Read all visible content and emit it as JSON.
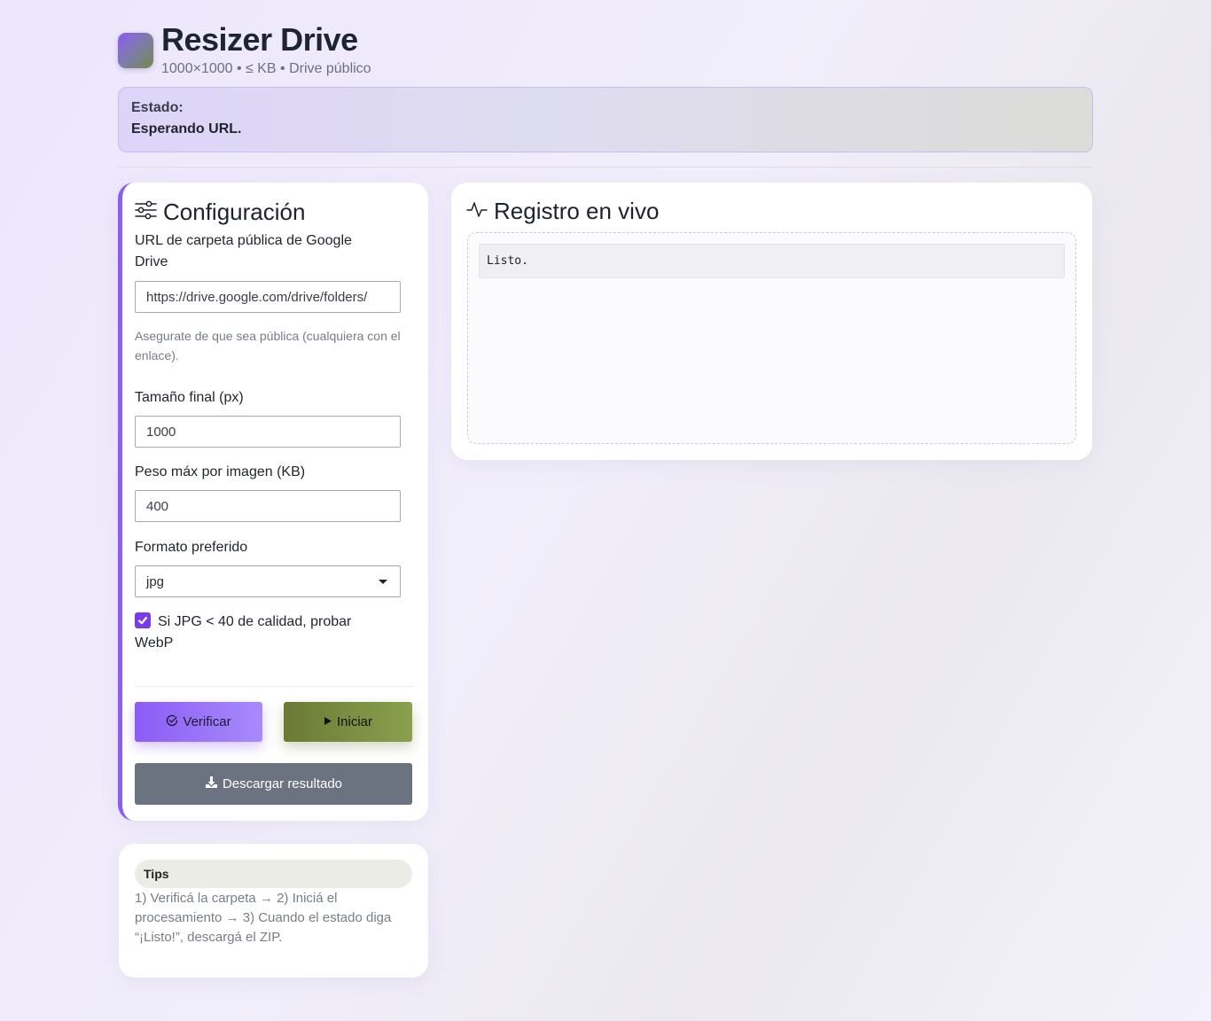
{
  "header": {
    "title": "Resizer Drive",
    "subtitle": "1000×1000 • ≤ KB • Drive público"
  },
  "status": {
    "label": "Estado:",
    "value": "Esperando URL."
  },
  "config": {
    "title": "Configuración",
    "url_label": "URL de carpeta pública de Google Drive",
    "url_value": "https://drive.google.com/drive/folders/",
    "url_hint": "Asegurate de que sea pública (cualquiera con el enlace).",
    "size_label": "Tamaño final (px)",
    "size_value": "1000",
    "weight_label": "Peso máx por imagen (KB)",
    "weight_value": "400",
    "format_label": "Formato preferido",
    "format_value": "jpg",
    "webp_checkbox_label": "Si JPG < 40 de calidad, probar WebP",
    "webp_checked": true,
    "verify_label": "Verificar",
    "start_label": "Iniciar",
    "download_label": "Descargar resultado"
  },
  "tips": {
    "badge": "Tips",
    "text": "1) Verificá la carpeta → 2) Iniciá el procesamiento → 3) Cuando el estado diga “¡Listo!”, descargá el ZIP."
  },
  "log": {
    "title": "Registro en vivo",
    "lines": [
      "Listo."
    ]
  },
  "colors": {
    "accent": "#8b5cf6",
    "start": "#6b7a35",
    "download": "#6b7280"
  },
  "icons": {
    "config": "sliders-icon",
    "log": "activity-icon",
    "verify": "check-circle-icon",
    "start": "play-icon",
    "download": "download-icon"
  }
}
